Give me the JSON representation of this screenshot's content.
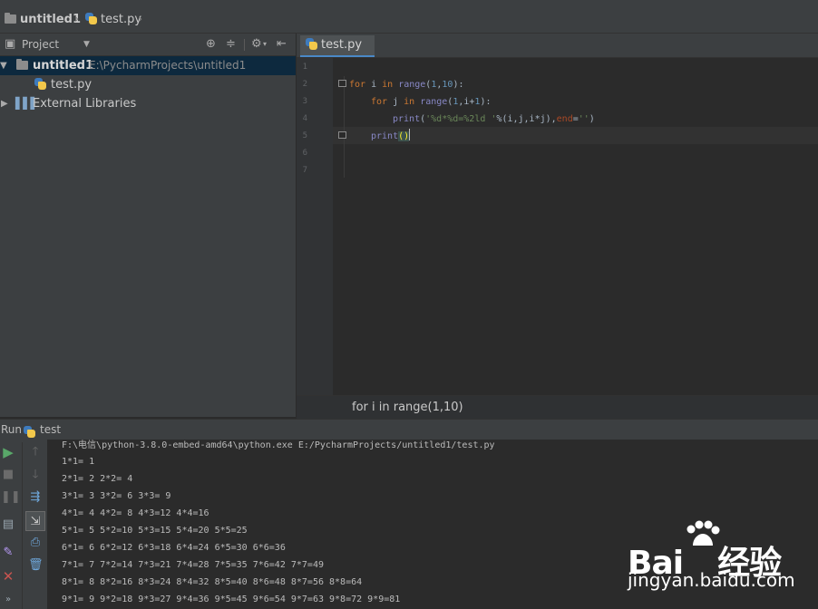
{
  "navbar": {
    "project": "untitled1",
    "file": "test.py"
  },
  "project_panel": {
    "title": "Project",
    "root_name": "untitled1",
    "root_path": "E:\\PycharmProjects\\untitled1",
    "file": "test.py",
    "external": "External Libraries"
  },
  "editor": {
    "tab": "test.py",
    "line_numbers": [
      "1",
      "2",
      "3",
      "4",
      "5",
      "6",
      "7"
    ],
    "line2": {
      "kw": "for",
      "var": " i ",
      "kw2": "in",
      "fn": " range",
      "open": "(",
      "n1": "1",
      "comma": ",",
      "n2": "10",
      "close": "):"
    },
    "line3": {
      "kw": "for",
      "var": " j ",
      "kw2": "in",
      "fn": " range",
      "open": "(",
      "n1": "1",
      "mid": ",i+",
      "n2": "1",
      "close": "):"
    },
    "line4": {
      "fn": "print",
      "open": "(",
      "str": "'%d*%d=%2ld '",
      "mid": "%(i,j,i*j),",
      "kwarg": "end",
      "eq": "=",
      "str2": "''",
      "close": ")"
    },
    "line5": {
      "fn": "print",
      "parens": "()"
    },
    "breadcrumb": "for i in range(1,10)"
  },
  "run": {
    "label": "Run",
    "config": "test",
    "command": "F:\\电信\\python-3.8.0-embed-amd64\\python.exe E:/PycharmProjects/untitled1/test.py",
    "output": [
      "1*1= 1",
      "2*1= 2 2*2= 4",
      "3*1= 3 3*2= 6 3*3= 9",
      "4*1= 4 4*2= 8 4*3=12 4*4=16",
      "5*1= 5 5*2=10 5*3=15 5*4=20 5*5=25",
      "6*1= 6 6*2=12 6*3=18 6*4=24 6*5=30 6*6=36",
      "7*1= 7 7*2=14 7*3=21 7*4=28 7*5=35 7*6=42 7*7=49",
      "8*1= 8 8*2=16 8*3=24 8*4=32 8*5=40 8*6=48 8*7=56 8*8=64",
      "9*1= 9 9*2=18 9*3=27 9*4=36 9*5=45 9*6=54 9*7=63 9*8=72 9*9=81"
    ]
  },
  "watermark": {
    "logo": "Baidu 经验",
    "url": "jingyan.baidu.com"
  }
}
